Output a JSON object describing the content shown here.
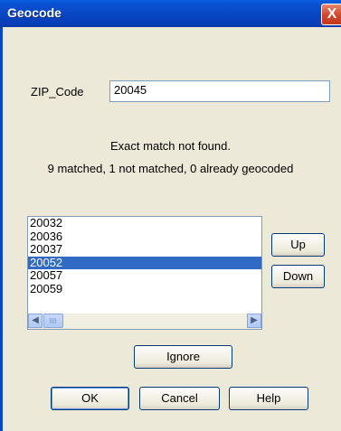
{
  "window": {
    "title": "Geocode",
    "close_glyph": "X"
  },
  "zip": {
    "label": "ZIP_Code",
    "value": "20045"
  },
  "messages": {
    "line1": "Exact match not found.",
    "line2": "9 matched, 1 not matched, 0 already geocoded"
  },
  "candidates": {
    "items": [
      "20032",
      "20036",
      "20037",
      "20052",
      "20057",
      "20059"
    ],
    "selected": "20052"
  },
  "buttons": {
    "up": "Up",
    "down": "Down",
    "ignore": "Ignore",
    "ok": "OK",
    "cancel": "Cancel",
    "help": "Help"
  },
  "icons": {
    "scroll_left": "left-arrow-icon",
    "scroll_right": "right-arrow-icon"
  }
}
